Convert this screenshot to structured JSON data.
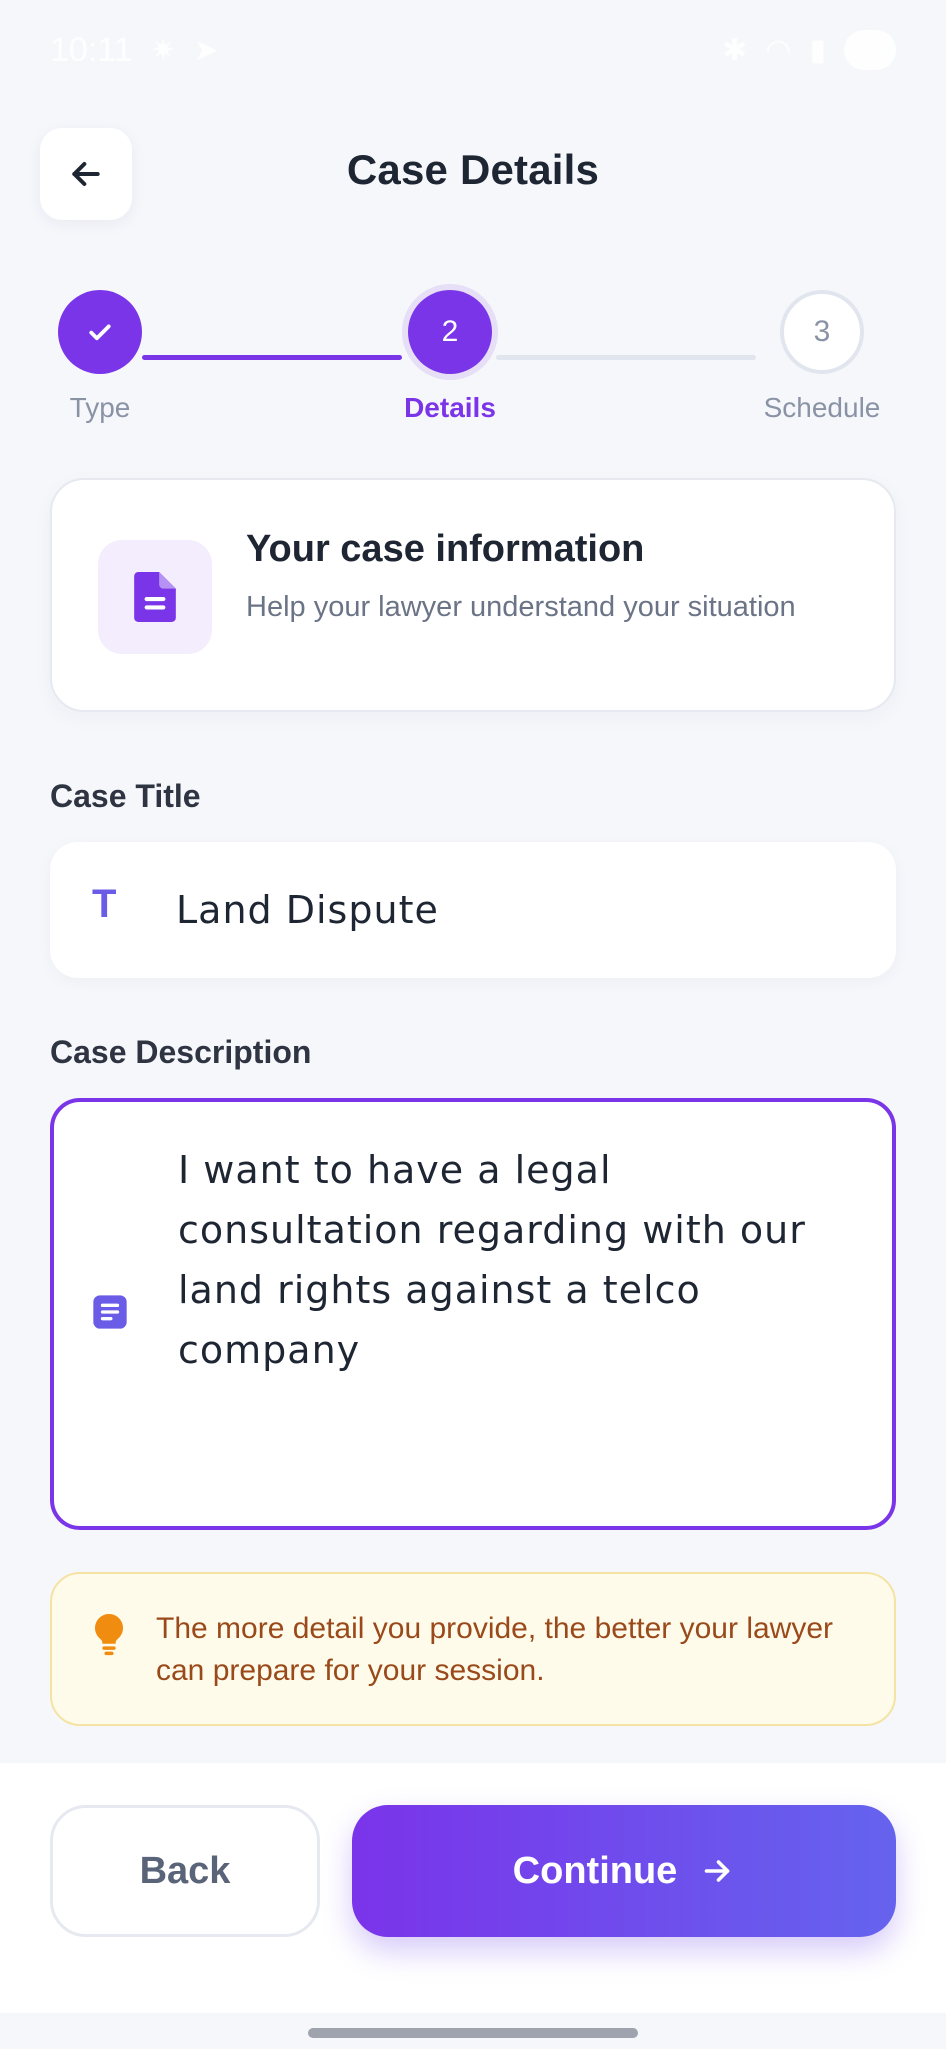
{
  "status_bar": {
    "time": "10:11"
  },
  "header": {
    "title": "Case Details"
  },
  "stepper": {
    "steps": [
      {
        "label": "Type",
        "number": "",
        "state": "done"
      },
      {
        "label": "Details",
        "number": "2",
        "state": "active"
      },
      {
        "label": "Schedule",
        "number": "3",
        "state": "pending"
      }
    ]
  },
  "info_card": {
    "title": "Your case information",
    "subtitle": "Help your lawyer understand your situation"
  },
  "case_title": {
    "label": "Case Title",
    "value": "Land Dispute"
  },
  "case_description": {
    "label": "Case Description",
    "value": "I want to have a legal consultation regarding with our land rights against a telco company"
  },
  "tip": {
    "text": "The more detail you provide, the better your lawyer can prepare for your session."
  },
  "footer": {
    "back_label": "Back",
    "continue_label": "Continue"
  },
  "colors": {
    "accent": "#7b35e8",
    "gradient_end": "#6563ee",
    "tip_text": "#9a4a1a",
    "tip_bg": "#fffbea"
  }
}
